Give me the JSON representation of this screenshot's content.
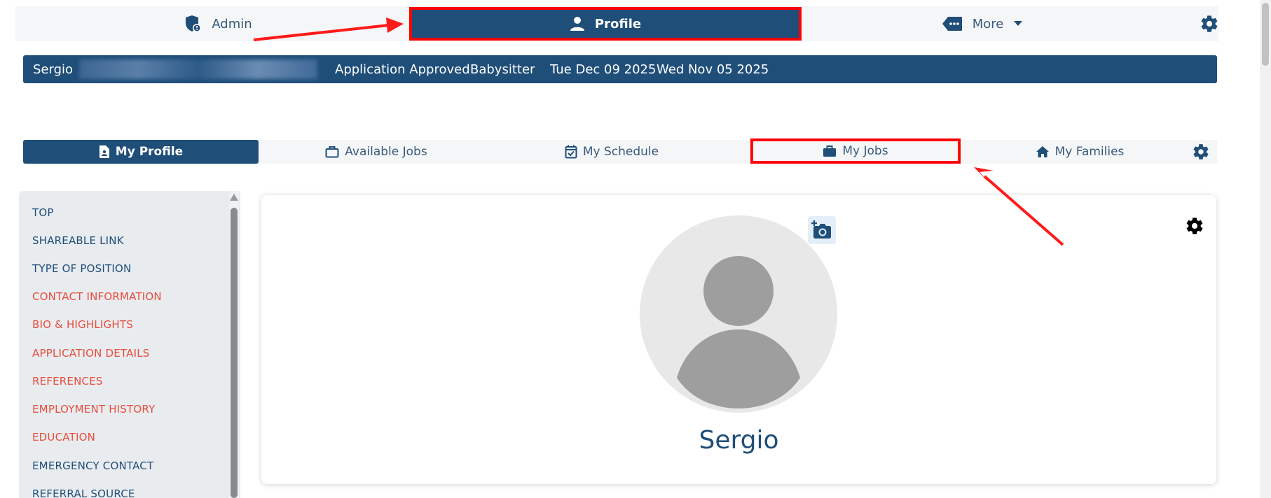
{
  "topnav": {
    "admin_label": "Admin",
    "profile_label": "Profile",
    "more_label": "More"
  },
  "infobar": {
    "name": "Sergio",
    "status": "Application Approved",
    "role": "Babysitter",
    "date1": "Tue Dec 09 2025",
    "date2": "Wed Nov 05 2025"
  },
  "tabs": [
    {
      "label": "My Profile"
    },
    {
      "label": "Available Jobs"
    },
    {
      "label": "My Schedule"
    },
    {
      "label": "My Jobs"
    },
    {
      "label": "My Families"
    }
  ],
  "sidenav": {
    "items": [
      {
        "label": "TOP",
        "status": "ok"
      },
      {
        "label": "SHAREABLE LINK",
        "status": "ok"
      },
      {
        "label": "TYPE OF POSITION",
        "status": "ok"
      },
      {
        "label": "CONTACT INFORMATION",
        "status": "required"
      },
      {
        "label": "BIO & HIGHLIGHTS",
        "status": "required"
      },
      {
        "label": "APPLICATION DETAILS",
        "status": "required"
      },
      {
        "label": "REFERENCES",
        "status": "required"
      },
      {
        "label": "EMPLOYMENT HISTORY",
        "status": "required"
      },
      {
        "label": "EDUCATION",
        "status": "required"
      },
      {
        "label": "EMERGENCY CONTACT",
        "status": "ok"
      },
      {
        "label": "REFERRAL SOURCE",
        "status": "ok"
      }
    ]
  },
  "profile": {
    "name": "Sergio"
  },
  "colors": {
    "primary": "#1f4e79",
    "required": "#e74c3c",
    "highlight": "#ff0000"
  }
}
